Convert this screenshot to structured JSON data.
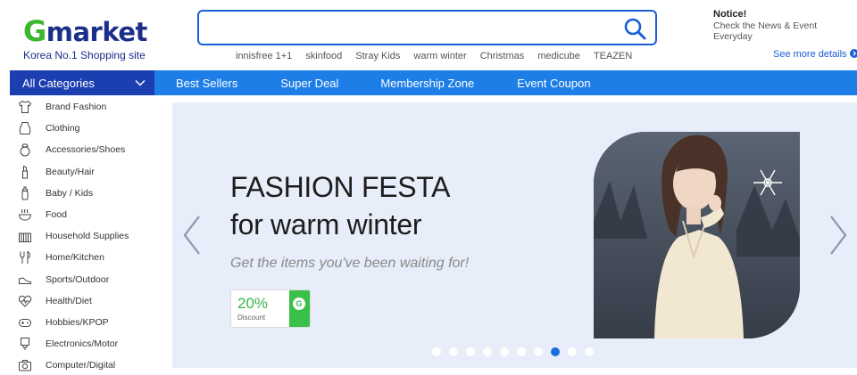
{
  "header": {
    "logo_g": "G",
    "logo_rest": "market",
    "tagline": "Korea No.1 Shopping site",
    "search_placeholder": "",
    "keywords": [
      "innisfree 1+1",
      "skinfood",
      "Stray Kids",
      "warm winter",
      "Christmas",
      "medicube",
      "TEAZEN"
    ],
    "notice": {
      "title": "Notice!",
      "text": "Check the News & Event Everyday",
      "see_more": "See more details"
    },
    "see_more_icon": "chevron-right-icon"
  },
  "nav": {
    "all_categories": "All Categories",
    "links": [
      "Best Sellers",
      "Super Deal",
      "Membership Zone",
      "Event Coupon"
    ]
  },
  "categories": [
    {
      "label": "Brand Fashion",
      "icon": "shirt-icon"
    },
    {
      "label": "Clothing",
      "icon": "clothing-icon"
    },
    {
      "label": "Accessories/Shoes",
      "icon": "ring-icon"
    },
    {
      "label": "Beauty/Hair",
      "icon": "lipstick-icon"
    },
    {
      "label": "Baby / Kids",
      "icon": "baby-bottle-icon"
    },
    {
      "label": "Food",
      "icon": "bowl-icon"
    },
    {
      "label": "Household Supplies",
      "icon": "household-icon"
    },
    {
      "label": "Home/Kitchen",
      "icon": "utensils-icon"
    },
    {
      "label": "Sports/Outdoor",
      "icon": "sneaker-icon"
    },
    {
      "label": "Health/Diet",
      "icon": "heart-pulse-icon"
    },
    {
      "label": "Hobbies/KPOP",
      "icon": "gamepad-icon"
    },
    {
      "label": "Electronics/Motor",
      "icon": "plug-icon"
    },
    {
      "label": "Computer/Digital",
      "icon": "camera-icon"
    }
  ],
  "banner": {
    "title_line1": "FASHION FESTA",
    "title_line2": "for warm winter",
    "subtitle": "Get the items you've been waiting for!",
    "coupon_value": "20%",
    "coupon_label": "Discount",
    "coupon_badge": "G",
    "slide_count": 10,
    "active_slide": 8
  },
  "colors": {
    "brand_blue": "#1b2e8a",
    "brand_green": "#3cb72e",
    "nav_blue": "#1e7ee8",
    "nav_dark": "#1b3eb0",
    "banner_bg": "#e7edf9",
    "accent": "#1a6fdc"
  }
}
